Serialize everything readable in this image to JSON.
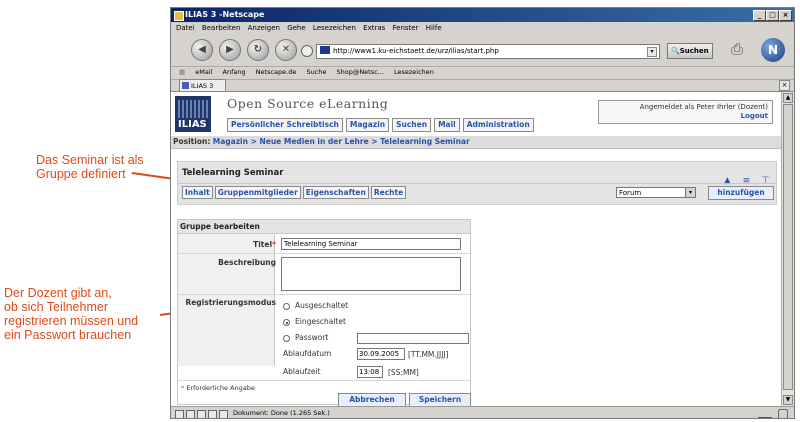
{
  "annotations": [
    "Das Seminar ist als\nGruppe definiert",
    "Der Dozent gibt an,\nob sich Teilnehmer\nregistrieren müssen und\nein Passwort brauchen"
  ],
  "browser": {
    "window_title": "ILIAS 3 -Netscape",
    "menu": [
      "Datei",
      "Bearbeiten",
      "Anzeigen",
      "Gehe",
      "Lesezeichen",
      "Extras",
      "Fenster",
      "Hilfe"
    ],
    "url": "http://www1.ku-eichstaett.de/urz/ilias/start.php",
    "search_label": "Suchen",
    "personal_toolbar": [
      "eMail",
      "Anfang",
      "Netscape.de",
      "Suche",
      "Shop@Netsc...",
      "Lesezeichen"
    ],
    "tab_label": "ILIAS 3",
    "status_text": "Dokument: Done (1.265 Sek.)"
  },
  "header": {
    "logo_text": "ILIAS",
    "title": "Open Source eLearning",
    "nav": [
      "Persönlicher Schreibtisch",
      "Magazin",
      "Suchen",
      "Mail",
      "Administration"
    ],
    "user_text": "Angemeldet als Peter Ihrler (Dozent)",
    "logout": "Logout"
  },
  "position": {
    "label": "Position:",
    "path": "Magazin > Neue Medien in der Lehre > Telelearning Seminar"
  },
  "group": {
    "title": "Telelearning Seminar",
    "tabs": [
      "Inhalt",
      "Gruppenmitglieder",
      "Eigenschaften",
      "Rechte"
    ],
    "select_value": "Forum",
    "add_button": "hinzufügen"
  },
  "form": {
    "header": "Gruppe bearbeiten",
    "title_label": "Titel",
    "title_value": "Telelearning Seminar",
    "description_label": "Beschreibung",
    "registration_label": "Registrierungsmodus",
    "options": [
      "Ausgeschaltet",
      "Eingeschaltet",
      "Passwort"
    ],
    "selected_option": "Eingeschaltet",
    "expiry_date_label": "Ablaufdatum",
    "expiry_date_value": "30.09.2005",
    "expiry_date_format": "[TT.MM.JJJJ]",
    "expiry_time_label": "Ablaufzeit",
    "expiry_time_value": "13:08",
    "expiry_time_format": "[SS:MM]",
    "required_note": "Erforderliche Angabe",
    "cancel_button": "Abbrechen",
    "save_button": "Speichern"
  },
  "colors": {
    "annotation": "#e04a1a",
    "link_blue": "#2a52a8",
    "logo_bg": "#20356c"
  }
}
